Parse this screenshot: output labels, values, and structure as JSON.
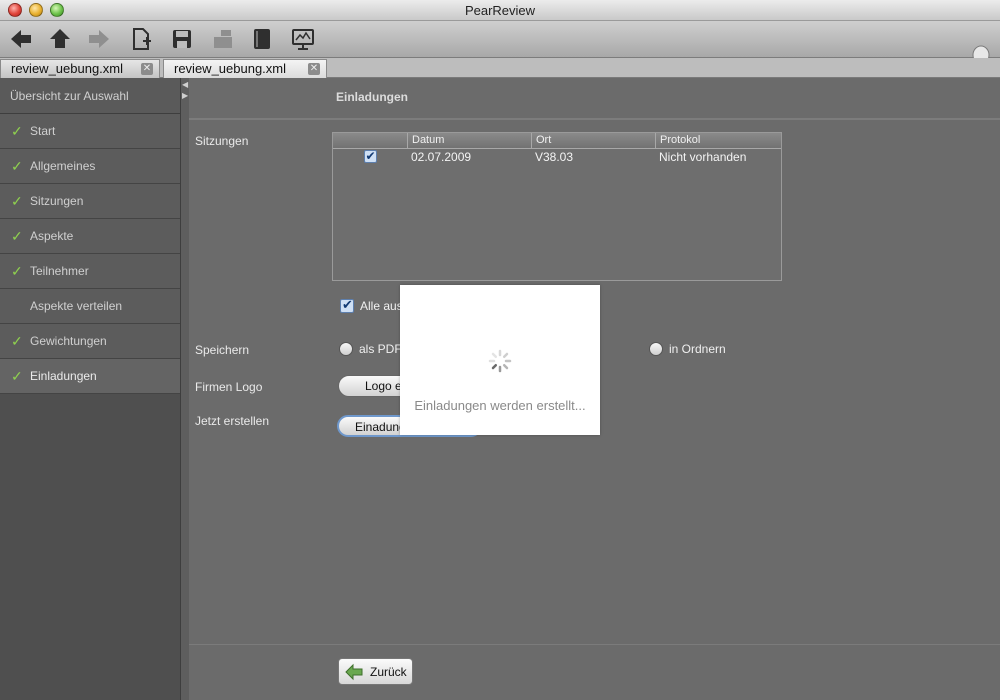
{
  "window": {
    "title": "PearReview"
  },
  "toolbar": {
    "buttons": [
      {
        "name": "back-icon"
      },
      {
        "name": "home-icon"
      },
      {
        "name": "forward-icon"
      },
      {
        "name": "new-document-icon"
      },
      {
        "name": "save-icon"
      },
      {
        "name": "import-icon"
      },
      {
        "name": "notebook-icon"
      },
      {
        "name": "presentation-icon"
      }
    ],
    "help": "lightbulb-icon"
  },
  "tabs": [
    {
      "label": "review_uebung.xml",
      "active": false
    },
    {
      "label": "review_uebung.xml",
      "active": true
    }
  ],
  "sidebar": {
    "header": "Übersicht zur Auswahl",
    "items": [
      {
        "label": "Start",
        "checked": true
      },
      {
        "label": "Allgemeines",
        "checked": true
      },
      {
        "label": "Sitzungen",
        "checked": true
      },
      {
        "label": "Aspekte",
        "checked": true
      },
      {
        "label": "Teilnehmer",
        "checked": true
      },
      {
        "label": "Aspekte verteilen",
        "checked": false
      },
      {
        "label": "Gewichtungen",
        "checked": true
      },
      {
        "label": "Einladungen",
        "checked": true,
        "selected": true
      }
    ]
  },
  "main": {
    "title": "Einladungen",
    "sessions_label": "Sitzungen",
    "table": {
      "columns": [
        "",
        "Datum",
        "Ort",
        "Protokol"
      ],
      "rows": [
        {
          "selected": true,
          "datum": "02.07.2009",
          "ort": "V38.03",
          "protokol": "Nicht vorhanden"
        }
      ]
    },
    "select_all_label": "Alle aus",
    "save_label": "Speichern",
    "save_options": [
      {
        "label": "als PDF"
      },
      {
        "label": "in Ordnern"
      }
    ],
    "logo_label": "Firmen Logo",
    "logo_button": "Logo e",
    "create_label": "Jetzt erstellen",
    "create_button": "Einadung",
    "back_button": "Zurück"
  },
  "overlay": {
    "message": "Einladungen werden erstellt..."
  },
  "colors": {
    "checkmark": "#8fd14f",
    "back_arrow": "#6aa84f",
    "button_focus": "#6f98cc"
  }
}
